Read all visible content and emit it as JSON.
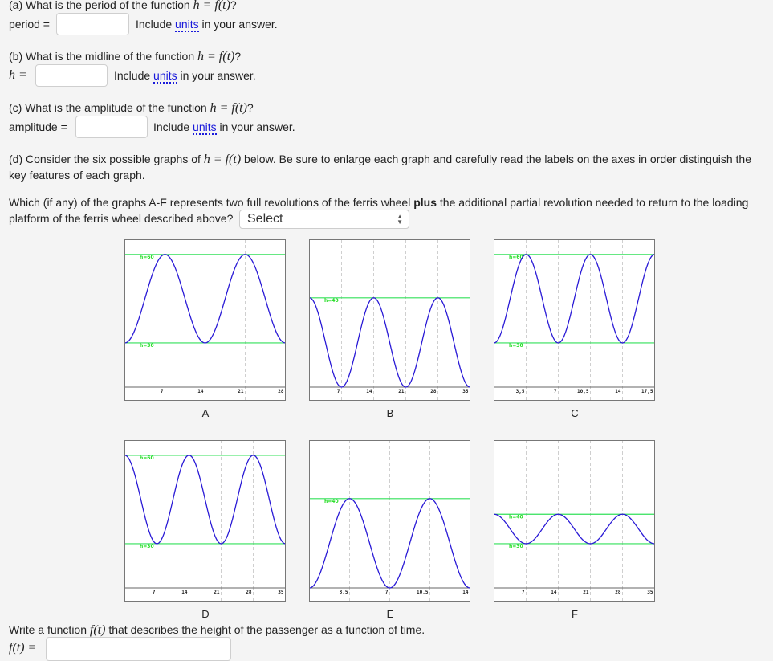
{
  "part_a": {
    "question_prefix": "(a) What is the period of the function ",
    "question_math": "h = f(t)",
    "question_suffix": "?",
    "field_label": "period =",
    "field_value": "",
    "hint_prefix": "Include ",
    "hint_link": "units",
    "hint_suffix": " in your answer."
  },
  "part_b": {
    "question_prefix": "(b) What is the midline of the function ",
    "question_math": "h = f(t)",
    "question_suffix": "?",
    "field_label": "h =",
    "field_value": "",
    "hint_prefix": "Include ",
    "hint_link": "units",
    "hint_suffix": " in your answer."
  },
  "part_c": {
    "question_prefix": "(c) What is the amplitude of the function ",
    "question_math": "h = f(t)",
    "question_suffix": "?",
    "field_label": "amplitude =",
    "field_value": "",
    "hint_prefix": "Include ",
    "hint_link": "units",
    "hint_suffix": " in your answer."
  },
  "part_d": {
    "intro_prefix": "(d) Consider the six possible graphs of ",
    "intro_math": "h = f(t)",
    "intro_suffix_line1": " below. Be sure to enlarge each graph and carefully read the labels on the axes in order distinguish the",
    "intro_line2": "key features of each graph.",
    "which_prefix": "Which (if any) of the graphs A-F represents two full revolutions of the ferris wheel ",
    "which_bold": "plus",
    "which_suffix_line1": " the additional partial revolution needed to return to the loading",
    "which_line2": "platform of the ferris wheel described above?",
    "select_value": "Select"
  },
  "part_e": {
    "prompt_prefix": "Write a function ",
    "prompt_math": "f(t)",
    "prompt_suffix": " that describes the height of the passenger as a function of time.",
    "field_label": "f(t) =",
    "field_value": ""
  },
  "colors": {
    "curve": "#2a1ad6",
    "reference_line": "#33e05a",
    "reference_label": "#22dd22",
    "link": "#1a1adb"
  },
  "chart_data": [
    {
      "type": "line",
      "label": "A",
      "xlim": [
        0,
        28
      ],
      "ylim": [
        15,
        65
      ],
      "xticks": [
        "7",
        "14",
        "21",
        "28"
      ],
      "xtick_values": [
        7,
        14,
        21,
        28
      ],
      "ref_lines": [
        {
          "label": "h=60",
          "y": 60
        },
        {
          "label": "h=30",
          "y": 30
        }
      ],
      "series": [
        {
          "name": "h",
          "function": "cosine",
          "min": 30,
          "max": 60,
          "period": 14,
          "start": "min"
        }
      ]
    },
    {
      "type": "line",
      "label": "B",
      "xlim": [
        0,
        35
      ],
      "ylim": [
        0,
        66
      ],
      "xticks": [
        "7",
        "14",
        "21",
        "28",
        "35"
      ],
      "xtick_values": [
        7,
        14,
        21,
        28,
        35
      ],
      "ref_lines": [
        {
          "label": "h=40",
          "y": 40
        }
      ],
      "series": [
        {
          "name": "h",
          "function": "cosine",
          "min": 0,
          "max": 40,
          "period": 14,
          "start": "max"
        }
      ]
    },
    {
      "type": "line",
      "label": "C",
      "xlim": [
        0,
        17.5
      ],
      "ylim": [
        15,
        65
      ],
      "xticks": [
        "3,5",
        "7",
        "10,5",
        "14",
        "17,5"
      ],
      "xtick_values": [
        3.5,
        7,
        10.5,
        14,
        17.5
      ],
      "ref_lines": [
        {
          "label": "h=60",
          "y": 60
        },
        {
          "label": "h=30",
          "y": 30
        }
      ],
      "series": [
        {
          "name": "h",
          "function": "cosine",
          "min": 30,
          "max": 60,
          "period": 7,
          "start": "min"
        }
      ]
    },
    {
      "type": "line",
      "label": "D",
      "xlim": [
        0,
        35
      ],
      "ylim": [
        15,
        65
      ],
      "xticks": [
        "7",
        "14",
        "21",
        "28",
        "35"
      ],
      "xtick_values": [
        7,
        14,
        21,
        28,
        35
      ],
      "ref_lines": [
        {
          "label": "h=60",
          "y": 60
        },
        {
          "label": "h=30",
          "y": 30
        }
      ],
      "series": [
        {
          "name": "h",
          "function": "cosine",
          "min": 30,
          "max": 60,
          "period": 14,
          "start": "max"
        }
      ]
    },
    {
      "type": "line",
      "label": "E",
      "xlim": [
        0,
        14
      ],
      "ylim": [
        0,
        66
      ],
      "xticks": [
        "3,5",
        "7",
        "10,5",
        "14"
      ],
      "xtick_values": [
        3.5,
        7,
        10.5,
        14
      ],
      "ref_lines": [
        {
          "label": "h=40",
          "y": 40
        }
      ],
      "series": [
        {
          "name": "h",
          "function": "cosine",
          "min": 0,
          "max": 40,
          "period": 7,
          "start": "min"
        }
      ]
    },
    {
      "type": "line",
      "label": "F",
      "xlim": [
        0,
        35
      ],
      "ylim": [
        15,
        65
      ],
      "xticks": [
        "7",
        "14",
        "21",
        "28",
        "35"
      ],
      "xtick_values": [
        7,
        14,
        21,
        28,
        35
      ],
      "ref_lines": [
        {
          "label": "h=40",
          "y": 40
        },
        {
          "label": "h=30",
          "y": 30
        }
      ],
      "series": [
        {
          "name": "h",
          "function": "cosine",
          "min": 30,
          "max": 40,
          "period": 14,
          "start": "max"
        }
      ]
    }
  ]
}
